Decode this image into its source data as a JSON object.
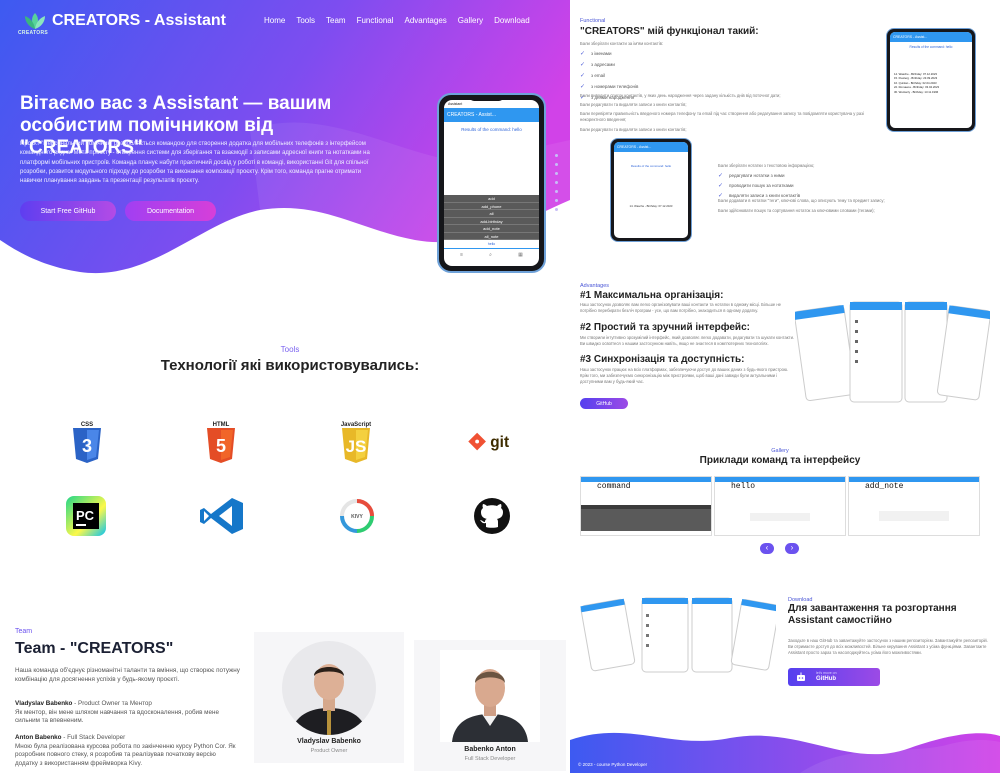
{
  "header": {
    "logo_text": "CREATORS",
    "brand": "CREATORS - Assistant",
    "nav": [
      "Home",
      "Tools",
      "Team",
      "Functional",
      "Advantages",
      "Gallery",
      "Download"
    ]
  },
  "hero": {
    "title": "Вітаємо вас з Assistant — вашим особистим помічником від \"CREATORS\"",
    "text": "Проєкт \"Персональний помічник\" розробляється командою для створення додатка для мобільних телефонів з інтерфейсом командного рядка. Мета проєкту - створення системи для зберігання та взаємодії з записами адресної книги та нотатками на платформі мобільних пристроїв. Команда планує набути практичний досвід у роботі в команді, використанні Git для спільної розробки, розвиток модульного підходу до розробки та виконання композиції проєкту. Крім того, команда прагне отримати навички планування завдань та презентації результатів проєкту.",
    "btn_github": "Start Free GitHub",
    "btn_docs": "Documentation",
    "phone": {
      "status": "Assistant",
      "appbar": "CREATORS - Assist...",
      "result": "Results of the command: hello",
      "commands": [
        "add",
        "add_phone",
        "all",
        "add-birthday",
        "add_note",
        "all_note"
      ],
      "input_hint": "hello"
    }
  },
  "tools": {
    "label": "Tools",
    "title": "Технології які використовувались:",
    "icons": [
      {
        "name": "css3-icon",
        "badge": "CSS",
        "color": "#2b63c6"
      },
      {
        "name": "html5-icon",
        "badge": "HTML",
        "color": "#e44d26"
      },
      {
        "name": "javascript-icon",
        "badge": "JavaScript",
        "color": "#e8b828"
      },
      {
        "name": "git-icon",
        "badge": "git",
        "color": "#f05133"
      },
      {
        "name": "pycharm-icon",
        "badge": "PC",
        "color": "#21d789"
      },
      {
        "name": "vscode-icon",
        "badge": "",
        "color": "#1577c9"
      },
      {
        "name": "kivy-icon",
        "badge": "KIVY",
        "color": "#7c7c7c"
      },
      {
        "name": "github-icon",
        "badge": "",
        "color": "#111111"
      }
    ]
  },
  "team": {
    "label": "Team",
    "title": "Team - \"CREATORS\"",
    "intro": "Наша команда об'єднує різноманітні таланти та вміння, що створює потужну комбінацію для досягнення успіхів у будь-якому проєкті.",
    "members": [
      {
        "name": "Vladyslav Babenko",
        "role": "Product Owner",
        "bio_title": "Vladyslav Babenko",
        "bio_role": " - Product Owner та Ментор",
        "bio": "Як ментор, він мене шляхом навчання та вдосконалення, робив мене сильним та впевненим."
      },
      {
        "name": "Babenko Anton",
        "role": "Full Stack Developer",
        "bio_title": "Anton Babenko",
        "bio_role": " - Full Stack Developer",
        "bio": "Мною була реалізована курсова робота по закінченню курсу Python Cor. Як розробник повного стеку, я розробив та реалізував початкову версію додатку з використанням фреймворка Kivy."
      }
    ]
  },
  "functional": {
    "label": "Functional",
    "title": "\"CREATORS\" мій функціонал такий:",
    "intro": "Бали зберігати контакти за ім'ям контактів:",
    "checks": [
      "з іменами",
      "з адресами",
      "з email",
      "з номерами телефонів",
      "з днями народження"
    ],
    "p1": "Бали виводити список контактів, у яких день народження через задану кількість днів від поточної дати;",
    "p2": "Бали редагувати та видаляти записи з книги контактів;",
    "p3": "Бали перевіряти правильність введеного номера телефону та email під час створення або редагування запису та повідомляти користувача у разі некоректного введення;",
    "p4": "Бали редагувати та видаляти записи з книги контактів;",
    "checks2_intro": "Бали зберігати нотатки з текстовою інформацією;",
    "checks2": [
      "редагувати нотатки з ними",
      "проводити пошук за нотатками",
      "видаляти записи з книги контактів"
    ],
    "p5": "Бали додавати в нотатки \"теги\", ключові слова, що описують тему та предмет запису;",
    "p6": "Бали здійснювати пошук та сортування нотаток за ключовими словами (тегами);",
    "phone_result": "Results of the command: hello",
    "phone_list": [
      "14. Wasche - Birthday: 07.12.2023",
      "15. Pewterg - Birthday: 23.09.2023",
      "16. Quinlan - Birthday: 02.04.2023",
      "22. Romaena - Birthday: 03.04.2023",
      "30. Wockerly - Birthday: 13.11.1996"
    ]
  },
  "advantages": {
    "label": "Advantages",
    "items": [
      {
        "title": "#1 Максимальна організація:",
        "text": "Наш застосунок дозволяє вам легко організовувати ваші контакти та нотатки в одному місці. Більше не потрібно перебирати безліч програм - усе, що вам потрібно, знаходиться в одному додатку."
      },
      {
        "title": "#2 Простий та зручний інтерфейс:",
        "text": "Ми створили інтуїтивно зрозумілий інтерфейс, який дозволяє легко додавати, редагувати та шукати контакти. Ви швидко освоїтеся з нашим застосунком навіть, якщо не знаєтеся в комп'ютерних технологіях."
      },
      {
        "title": "#3 Синхронізація та доступність:",
        "text": "Наш застосунок працює на всіх платформах, забезпечуючи доступ до ваших даних з будь-якого пристрою. Крім того, ми забезпечуємо синхронізацію між пристроями, щоб ваші дані завжди були актуальними і доступними вам у будь-який час."
      }
    ],
    "button": "GitHub"
  },
  "gallery": {
    "label": "Gallery",
    "title": "Приклади команд та інтерфейсу",
    "cards": [
      "command",
      "hello",
      "add_note"
    ],
    "prev": "‹",
    "next": "›"
  },
  "download": {
    "label": "Download",
    "title": "Для завантаження та розгортання Assistant самостійно",
    "text": "Заходьте в наш GitHub та завантажуйте застосунок з нашим репозиторієм. Завантажуйте репозиторій. Ви отримаєте доступ до всіх можливостей. Вільне керування Assistant з усіма функціями. Завантажте Assistant просто зараз та насолоджуйтесь усіма його можливостями.",
    "button_small": "let's move on",
    "button": "GitHub"
  },
  "footer": {
    "copyright": "© 2023 - course Python Developer"
  },
  "colors": {
    "hero_start": "#3d5af1",
    "hero_end": "#d142e8",
    "accent": "#6b52ef",
    "appbar": "#2f97f0"
  }
}
